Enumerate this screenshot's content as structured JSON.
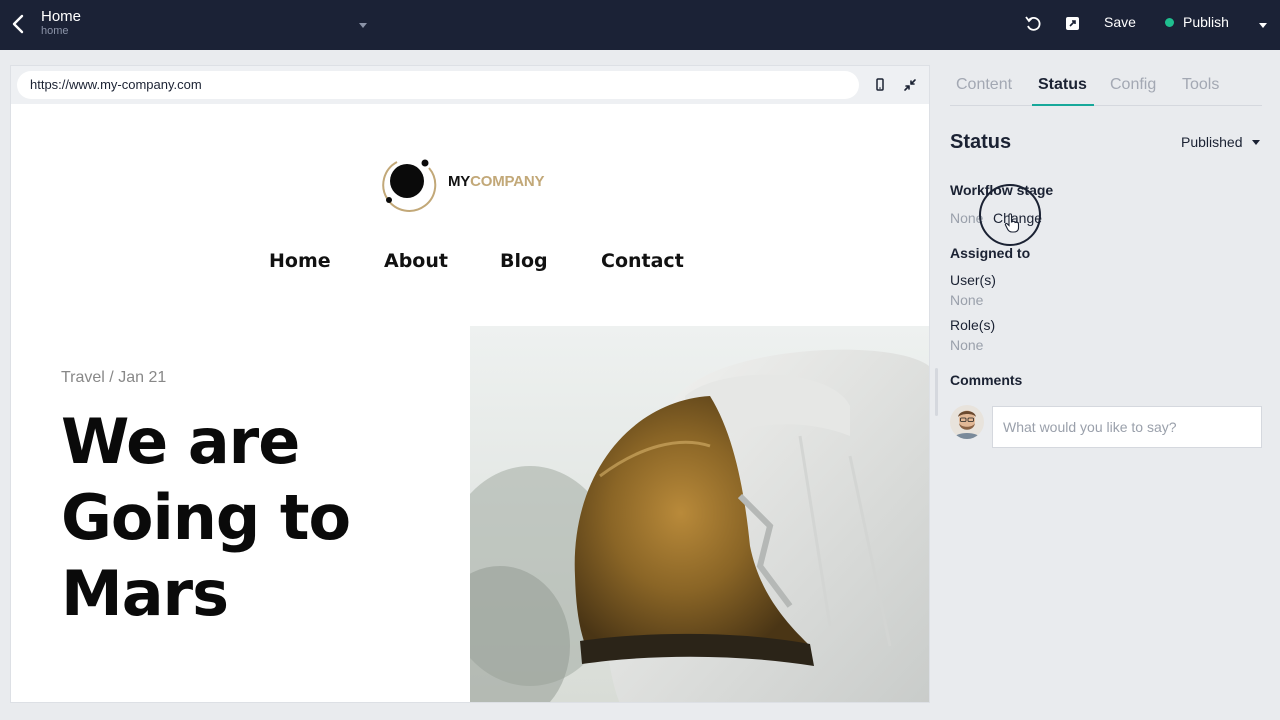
{
  "header": {
    "title": "Home",
    "slug": "home",
    "save_label": "Save",
    "publish_label": "Publish",
    "publish_dot_color": "#1fbf8f",
    "icons": [
      "back-arrow-icon",
      "chevron-down-icon",
      "undo-icon",
      "external-link-icon",
      "chevron-down-icon"
    ]
  },
  "preview": {
    "url": "https://www.my-company.com",
    "icons": [
      "mobile-device-icon",
      "collapse-icon"
    ],
    "logo": {
      "part1": "MY",
      "part2": "COMPANY"
    },
    "nav": [
      "Home",
      "About",
      "Blog",
      "Contact"
    ],
    "meta": "Travel / Jan 21",
    "headline_lines": [
      "We are",
      "Going to",
      "Mars"
    ]
  },
  "panel": {
    "tabs": [
      "Content",
      "Status",
      "Config",
      "Tools"
    ],
    "active_tab": "Status",
    "heading": "Status",
    "status_value": "Published",
    "workflow_label": "Workflow stage",
    "workflow_value": "None",
    "change_label": "Change",
    "assigned_label": "Assigned to",
    "users_label": "User(s)",
    "users_value": "None",
    "roles_label": "Role(s)",
    "roles_value": "None",
    "comments_label": "Comments",
    "comment_placeholder": "What would you like to say?"
  },
  "colors": {
    "topbar": "#1b2236",
    "accent": "#17a89a",
    "logo_gold": "#c2a878"
  }
}
